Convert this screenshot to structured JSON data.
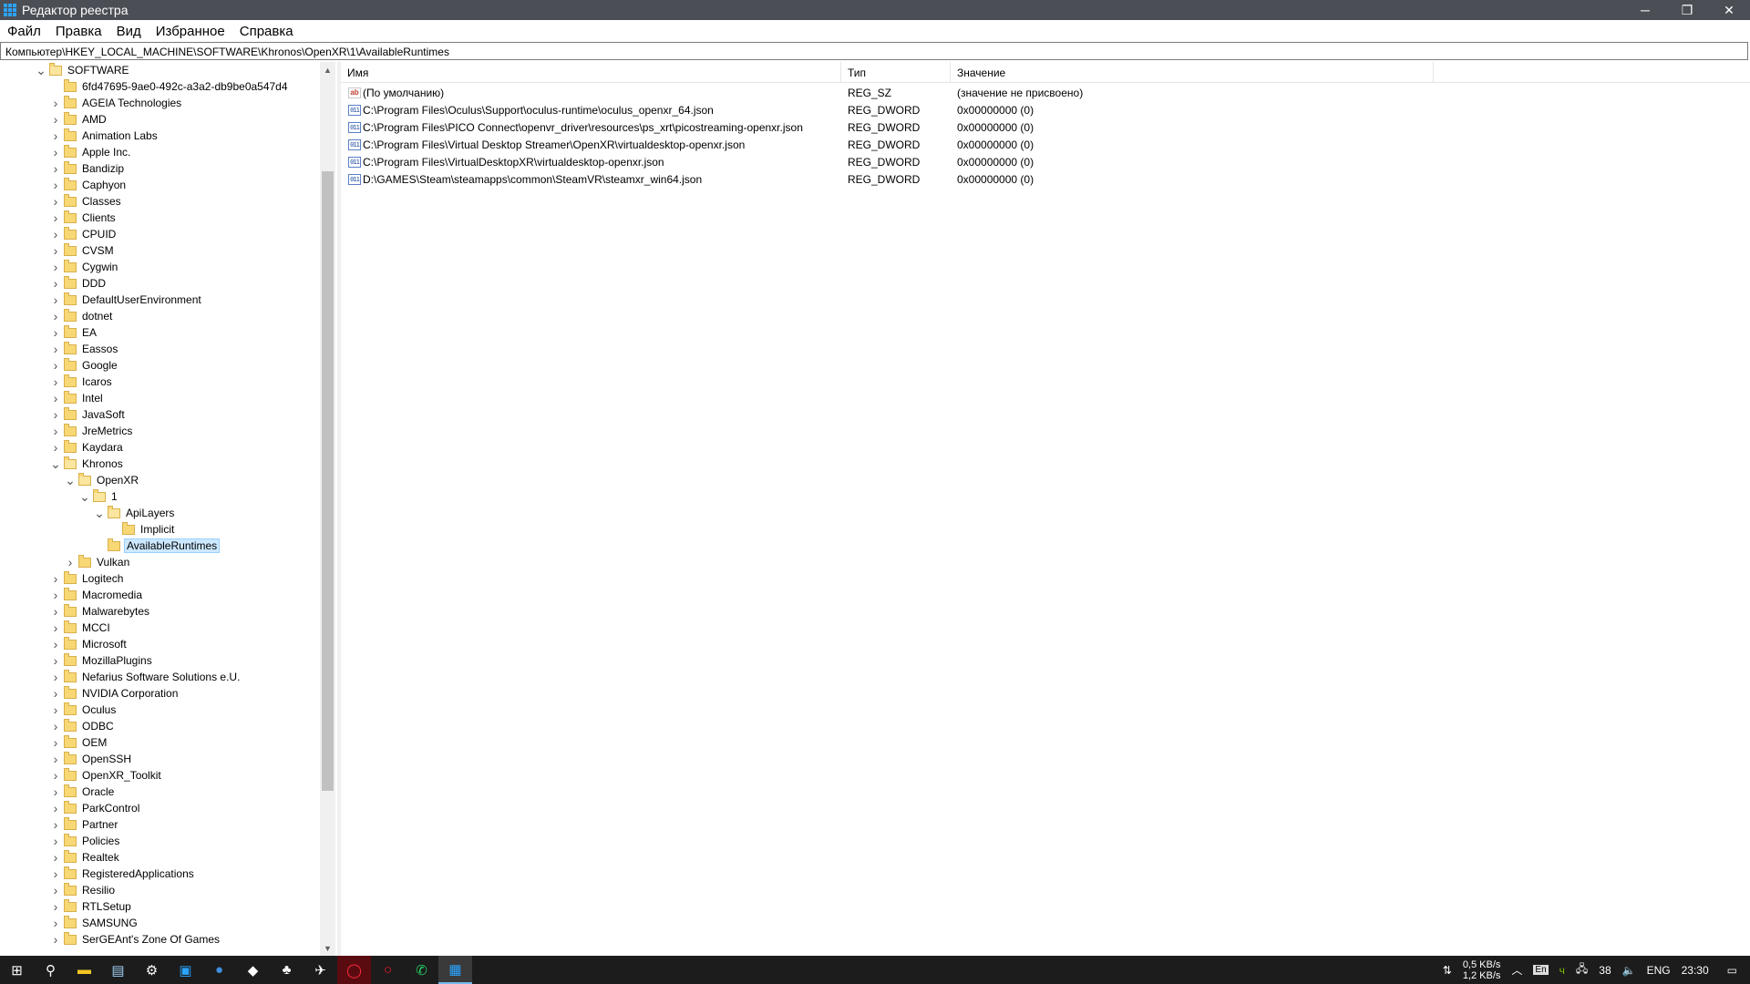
{
  "window": {
    "title": "Редактор реестра",
    "controls": {
      "minimize": "─",
      "maximize": "❐",
      "close": "✕"
    }
  },
  "menu": [
    "Файл",
    "Правка",
    "Вид",
    "Избранное",
    "Справка"
  ],
  "address": "Компьютер\\HKEY_LOCAL_MACHINE\\SOFTWARE\\Khronos\\OpenXR\\1\\AvailableRuntimes",
  "tree": {
    "root": "SOFTWARE",
    "items": [
      {
        "label": "6fd47695-9ae0-492c-a3a2-db9be0a547d4",
        "level": 1,
        "expander": "none"
      },
      {
        "label": "AGEIA Technologies",
        "level": 1,
        "expander": "collapsed"
      },
      {
        "label": "AMD",
        "level": 1,
        "expander": "collapsed"
      },
      {
        "label": "Animation Labs",
        "level": 1,
        "expander": "collapsed"
      },
      {
        "label": "Apple Inc.",
        "level": 1,
        "expander": "collapsed"
      },
      {
        "label": "Bandizip",
        "level": 1,
        "expander": "collapsed"
      },
      {
        "label": "Caphyon",
        "level": 1,
        "expander": "collapsed"
      },
      {
        "label": "Classes",
        "level": 1,
        "expander": "collapsed"
      },
      {
        "label": "Clients",
        "level": 1,
        "expander": "collapsed"
      },
      {
        "label": "CPUID",
        "level": 1,
        "expander": "collapsed"
      },
      {
        "label": "CVSM",
        "level": 1,
        "expander": "collapsed"
      },
      {
        "label": "Cygwin",
        "level": 1,
        "expander": "collapsed"
      },
      {
        "label": "DDD",
        "level": 1,
        "expander": "collapsed"
      },
      {
        "label": "DefaultUserEnvironment",
        "level": 1,
        "expander": "collapsed"
      },
      {
        "label": "dotnet",
        "level": 1,
        "expander": "collapsed"
      },
      {
        "label": "EA",
        "level": 1,
        "expander": "collapsed"
      },
      {
        "label": "Eassos",
        "level": 1,
        "expander": "collapsed"
      },
      {
        "label": "Google",
        "level": 1,
        "expander": "collapsed"
      },
      {
        "label": "Icaros",
        "level": 1,
        "expander": "collapsed"
      },
      {
        "label": "Intel",
        "level": 1,
        "expander": "collapsed"
      },
      {
        "label": "JavaSoft",
        "level": 1,
        "expander": "collapsed"
      },
      {
        "label": "JreMetrics",
        "level": 1,
        "expander": "collapsed"
      },
      {
        "label": "Kaydara",
        "level": 1,
        "expander": "collapsed"
      },
      {
        "label": "Khronos",
        "level": 1,
        "expander": "expanded"
      },
      {
        "label": "OpenXR",
        "level": 2,
        "expander": "expanded"
      },
      {
        "label": "1",
        "level": 3,
        "expander": "expanded"
      },
      {
        "label": "ApiLayers",
        "level": 4,
        "expander": "expanded"
      },
      {
        "label": "Implicit",
        "level": 5,
        "expander": "none"
      },
      {
        "label": "AvailableRuntimes",
        "level": 4,
        "expander": "none",
        "selected": true
      },
      {
        "label": "Vulkan",
        "level": 2,
        "expander": "collapsed"
      },
      {
        "label": "Logitech",
        "level": 1,
        "expander": "collapsed"
      },
      {
        "label": "Macromedia",
        "level": 1,
        "expander": "collapsed"
      },
      {
        "label": "Malwarebytes",
        "level": 1,
        "expander": "collapsed"
      },
      {
        "label": "MCCI",
        "level": 1,
        "expander": "collapsed"
      },
      {
        "label": "Microsoft",
        "level": 1,
        "expander": "collapsed"
      },
      {
        "label": "MozillaPlugins",
        "level": 1,
        "expander": "collapsed"
      },
      {
        "label": "Nefarius Software Solutions e.U.",
        "level": 1,
        "expander": "collapsed"
      },
      {
        "label": "NVIDIA Corporation",
        "level": 1,
        "expander": "collapsed"
      },
      {
        "label": "Oculus",
        "level": 1,
        "expander": "collapsed"
      },
      {
        "label": "ODBC",
        "level": 1,
        "expander": "collapsed"
      },
      {
        "label": "OEM",
        "level": 1,
        "expander": "collapsed"
      },
      {
        "label": "OpenSSH",
        "level": 1,
        "expander": "collapsed"
      },
      {
        "label": "OpenXR_Toolkit",
        "level": 1,
        "expander": "collapsed"
      },
      {
        "label": "Oracle",
        "level": 1,
        "expander": "collapsed"
      },
      {
        "label": "ParkControl",
        "level": 1,
        "expander": "collapsed"
      },
      {
        "label": "Partner",
        "level": 1,
        "expander": "collapsed"
      },
      {
        "label": "Policies",
        "level": 1,
        "expander": "collapsed"
      },
      {
        "label": "Realtek",
        "level": 1,
        "expander": "collapsed"
      },
      {
        "label": "RegisteredApplications",
        "level": 1,
        "expander": "collapsed"
      },
      {
        "label": "Resilio",
        "level": 1,
        "expander": "collapsed"
      },
      {
        "label": "RTLSetup",
        "level": 1,
        "expander": "collapsed"
      },
      {
        "label": "SAMSUNG",
        "level": 1,
        "expander": "collapsed"
      },
      {
        "label": "SerGEAnt's Zone Of Games",
        "level": 1,
        "expander": "collapsed"
      }
    ]
  },
  "list": {
    "columns": [
      "Имя",
      "Тип",
      "Значение"
    ],
    "rows": [
      {
        "icon": "string-value-icon",
        "name": "(По умолчанию)",
        "type": "REG_SZ",
        "value": "(значение не присвоено)"
      },
      {
        "icon": "dword-value-icon",
        "name": "C:\\Program Files\\Oculus\\Support\\oculus-runtime\\oculus_openxr_64.json",
        "type": "REG_DWORD",
        "value": "0x00000000 (0)"
      },
      {
        "icon": "dword-value-icon",
        "name": "C:\\Program Files\\PICO Connect\\openvr_driver\\resources\\ps_xrt\\picostreaming-openxr.json",
        "type": "REG_DWORD",
        "value": "0x00000000 (0)"
      },
      {
        "icon": "dword-value-icon",
        "name": "C:\\Program Files\\Virtual Desktop Streamer\\OpenXR\\virtualdesktop-openxr.json",
        "type": "REG_DWORD",
        "value": "0x00000000 (0)"
      },
      {
        "icon": "dword-value-icon",
        "name": "C:\\Program Files\\VirtualDesktopXR\\virtualdesktop-openxr.json",
        "type": "REG_DWORD",
        "value": "0x00000000 (0)"
      },
      {
        "icon": "dword-value-icon",
        "name": "D:\\GAMES\\Steam\\steamapps\\common\\SteamVR\\steamxr_win64.json",
        "type": "REG_DWORD",
        "value": "0x00000000 (0)"
      }
    ]
  },
  "taskbar": {
    "apps": [
      "start-icon",
      "search-icon",
      "file-explorer-icon",
      "notepad-icon",
      "settings-icon",
      "store-icon",
      "browser-icon",
      "app-icon",
      "gamepad-icon",
      "plane-icon",
      "opera-gx-icon",
      "opera-icon",
      "whatsapp-icon",
      "regedit-icon"
    ],
    "tray": {
      "net_up": "0,5 KB/s",
      "net_down": "1,2 KB/s",
      "lang_indicator": "En",
      "temp": "38",
      "lang": "ENG",
      "time": "23:30"
    }
  }
}
